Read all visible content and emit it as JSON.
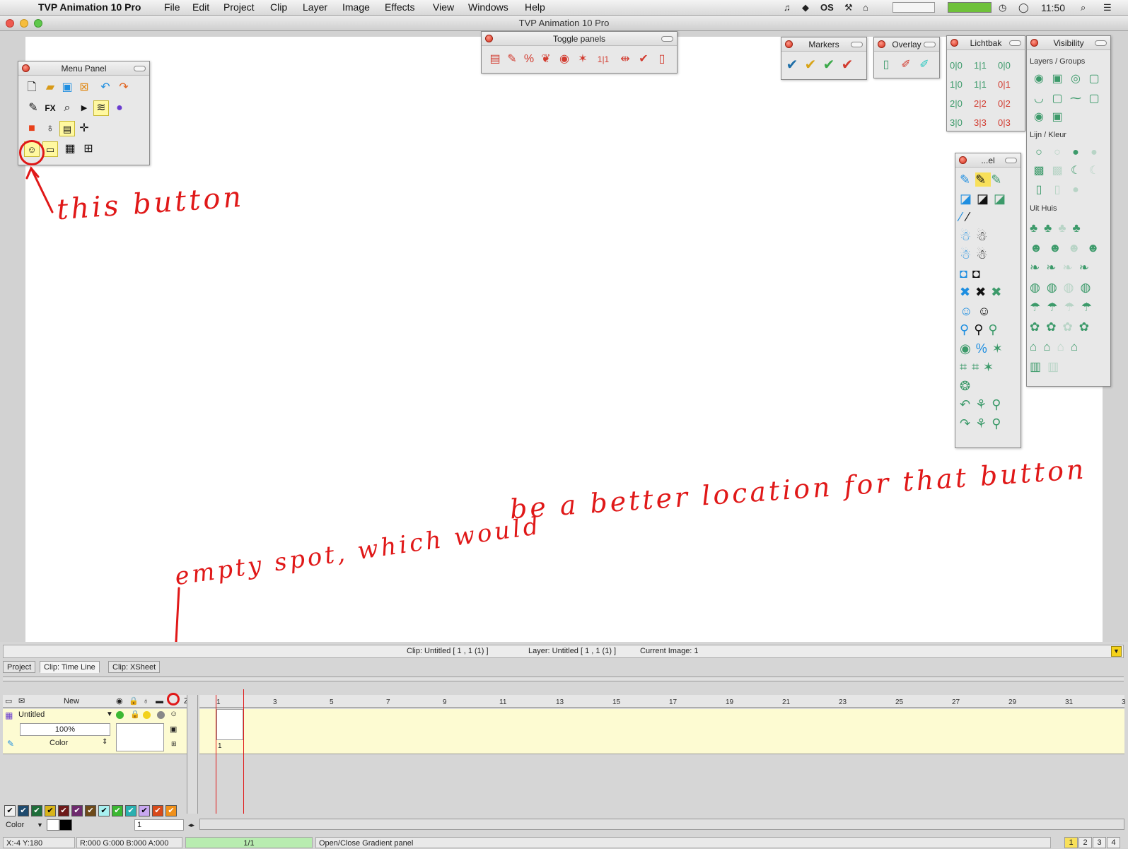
{
  "menubar": {
    "app_name": "TVP Animation 10 Pro",
    "items": [
      "File",
      "Edit",
      "Project",
      "Clip",
      "Layer",
      "Image",
      "Effects",
      "View",
      "Windows",
      "Help"
    ],
    "status_icons": [
      "twitter-icon",
      "dropbox-icon",
      "os-icon",
      "tool-icon",
      "network-icon",
      "battery-icon",
      "time-machine-icon",
      "chat-icon",
      "search-icon",
      "list-icon"
    ],
    "os_label": "OS",
    "clock": "11:50"
  },
  "window": {
    "title": "TVP Animation 10 Pro"
  },
  "panels": {
    "menu_panel": {
      "title": "Menu Panel"
    },
    "toggle_panels": {
      "title": "Toggle panels",
      "counter": "1|1"
    },
    "markers": {
      "title": "Markers"
    },
    "overlay": {
      "title": "Overlay"
    },
    "lichtbak": {
      "title": "Lichtbak",
      "rows": [
        [
          "0|0",
          "1|1",
          "0|0"
        ],
        [
          "1|0",
          "1|1",
          "0|1"
        ],
        [
          "2|0",
          "2|2",
          "0|2"
        ],
        [
          "3|0",
          "3|3",
          "0|3"
        ]
      ]
    },
    "visibility": {
      "title": "Visibility",
      "sections": [
        "Layers / Groups",
        "Lijn / Kleur",
        "Uit Huis"
      ]
    },
    "tools": {
      "title": "...el"
    }
  },
  "annotations": {
    "top": "this button",
    "bottom_main": "be a better location for that button",
    "bottom_lead": "empty spot, which would"
  },
  "info_bar": {
    "clip": "Clip: Untitled [ 1 , 1  (1) ]",
    "layer": "Layer: Untitled [ 1 , 1  (1) ]",
    "current_image": "Current Image: 1"
  },
  "tabs": [
    "Project",
    "Clip: Time Line",
    "Clip: XSheet"
  ],
  "timeline": {
    "new_label": "New",
    "z_label": "Z",
    "layer_name": "Untitled",
    "opacity": "100%",
    "blend_mode": "Color",
    "frame_label": "1",
    "ruler": [
      "1",
      "3",
      "5",
      "7",
      "9",
      "11",
      "13",
      "15",
      "17",
      "19",
      "21",
      "23",
      "25",
      "27",
      "29",
      "31",
      "3"
    ],
    "color_mode": "Color",
    "color_index": "1"
  },
  "statusbar": {
    "coords": "X:-4   Y:180",
    "rgba": "R:000 G:000 B:000 A:000",
    "progress": "1/1",
    "tooltip": "Open/Close Gradient panel",
    "pages": [
      "1",
      "2",
      "3",
      "4"
    ]
  },
  "colors": {
    "accent_red": "#e01818",
    "panel_green": "#3c9a6a",
    "timeline_yellow": "#fdfbd2"
  }
}
